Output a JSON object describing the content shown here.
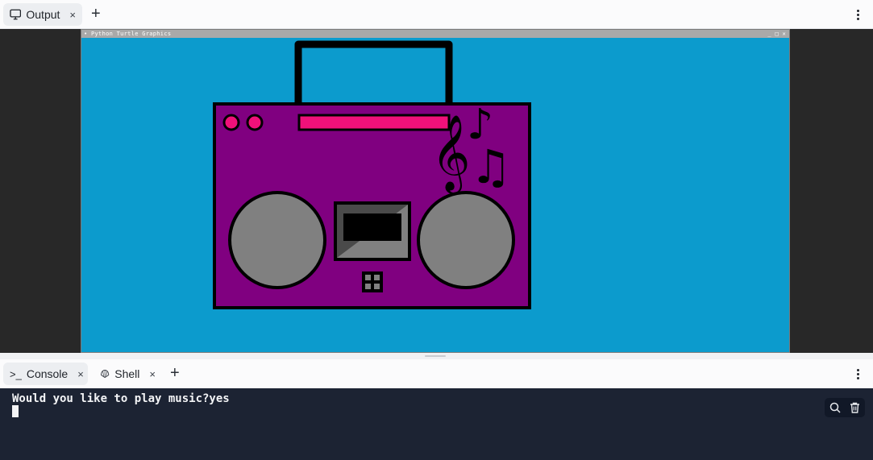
{
  "top_tabs": {
    "output_label": "Output",
    "close_glyph": "×",
    "add_glyph": "+"
  },
  "turtle_window": {
    "title": "• Python Turtle Graphics",
    "controls": "_ □ ✕",
    "background": "#0c9bcd",
    "boombox_color": "#800080",
    "tuner_color": "#f0117a",
    "speaker_color": "#808080",
    "music_glyphs": "𝄞♪♫"
  },
  "console_tabs": {
    "console_label": "Console",
    "console_prefix": ">_",
    "shell_label": "Shell",
    "close_glyph": "×",
    "add_glyph": "+"
  },
  "console": {
    "output_line": "Would you like to play music?yes",
    "background": "#1c2333"
  }
}
